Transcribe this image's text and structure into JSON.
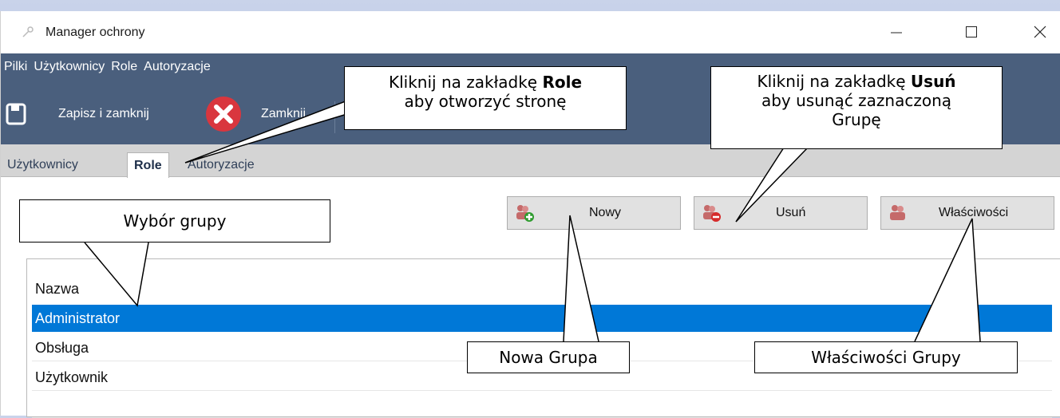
{
  "window": {
    "title": "Manager ochrony",
    "controls": {
      "minimize": "—",
      "maximize": "☐",
      "close": "✕"
    }
  },
  "menu": {
    "items": [
      "Pilki",
      "Użytkownicy",
      "Role",
      "Autoryzacje"
    ]
  },
  "toolbar": {
    "save_label": "Zapisz i zamknij",
    "close_label": "Zamknij"
  },
  "tabs": [
    {
      "label": "Użytkownicy",
      "active": false
    },
    {
      "label": "Role",
      "active": true
    },
    {
      "label": "Autoryzacje",
      "active": false
    }
  ],
  "buttons": {
    "new": "Nowy",
    "delete": "Usuń",
    "properties": "Właściwości"
  },
  "list": {
    "header": "Nazwa",
    "rows": [
      "Administrator",
      "Obsługa",
      "Użytkownik"
    ],
    "selected_index": 0
  },
  "callouts": {
    "role_tab": {
      "line1_prefix": "Kliknij na zakładkę ",
      "line1_bold": "Role",
      "line2": "aby otworzyć stronę"
    },
    "delete": {
      "line1_prefix": "Kliknij na zakładkę ",
      "line1_bold": "Usuń",
      "line2": "aby usunąć zaznaczoną",
      "line3": "Grupę"
    },
    "group_select": "Wybór grupy",
    "new_group": "Nowa Grupa",
    "group_props": "Właściwości Grupy"
  },
  "colors": {
    "menubar": "#4a5f7d",
    "selection": "#0078d7",
    "close_icon": "#d9363e"
  }
}
